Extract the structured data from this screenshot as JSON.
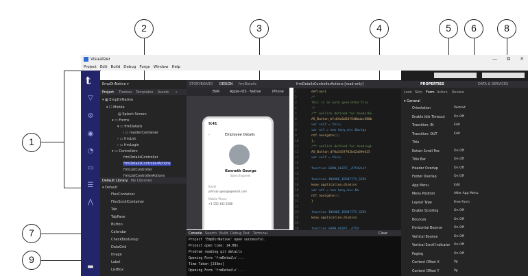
{
  "callouts": [
    "1",
    "2",
    "3",
    "4",
    "5",
    "6",
    "7",
    "8",
    "9"
  ],
  "window": {
    "title": "Visualizer",
    "min": "—",
    "restore": "⧉",
    "close": "✕"
  },
  "menu": [
    "Project",
    "Edit",
    "Build",
    "Debug",
    "Forge",
    "Window",
    "Help"
  ],
  "rail": {
    "logo": "t"
  },
  "project": {
    "selector": "EmpDirNative ▾",
    "tabs": [
      "Project",
      "Themes",
      "Templates",
      "Assets"
    ],
    "tree": [
      "▾ ▦ EmpDirNative",
      "▾ ☐ Mobile",
      "▤ Splash Screen",
      "▾ ▭ Forms",
      "▾ ▭ frmDetails",
      "› ▭ masterContainer",
      "› ▭ frmList",
      "› ▭ frmLogin",
      "▾ ▭ Controllers",
      "frmDetailsController",
      "frmDetailsControllerActions",
      "frmListController",
      "frmListControllerActions"
    ],
    "selected_index": 10
  },
  "library": {
    "tabs": [
      "Default Library",
      "My Libraries"
    ],
    "section": "▾ Default",
    "items": [
      "FlexContainer",
      "FlexScrollContainer",
      "Tab",
      "TabPane",
      "Button",
      "Calendar",
      "CheckBoxGroup",
      "DataGrid",
      "Image",
      "Label",
      "ListBox"
    ]
  },
  "design": {
    "tabs": [
      "STORYBOARD",
      "DESIGN",
      "frmDetails"
    ],
    "toolbar": [
      "BVR",
      "Apple-iOS · Native",
      "iPhone"
    ],
    "phone": {
      "time": "9:41",
      "title": "Employee Details",
      "name": "Kenneth George",
      "role": "Sales Engineer",
      "field1": "Email",
      "value1": "johnson.george@email.com",
      "field2": "Mobile Phone",
      "value2": "+1 555 443 5588"
    }
  },
  "editor": {
    "tab": "frmDetailsControllerActions [read-only]",
    "lines": [
      "define({",
      "  /*",
      "    This is an auto generated file",
      "  */",
      "  /** onClick defined for headerBu",
      "  AS_Button_bfc64c6d54f546babc500b",
      "      var self = this;",
      "      var ntf = new kony.mvc.Naviga",
      "      ntf.navigate();",
      "  },",
      "  /** onClick defined for headingL",
      "  AS_Button_df0a343f702b42a69ed25",
      "      var self = this;",
      "",
      "      function SHOW_ALERT__d7542a1f",
      "",
      "      function INVOKE_IDENTITY_SERV",
      "          kony.application.dismiss",
      "          var ntf = new kony.mvc.Na",
      "          ntf.navigate();",
      "      }",
      "",
      "      function INVOKE_IDENTITY_SERV",
      "          kony.application.dismiss",
      "",
      "      function SHOW_ALERT__d754"
    ]
  },
  "top_right": {
    "tabs": [
      "PROPERTIES",
      "DATA & SERVICES"
    ]
  },
  "props": {
    "tabs": [
      "Look",
      "Skin",
      "Form",
      "Action",
      "Review"
    ],
    "section": "▾ General",
    "rows": [
      {
        "label": "Orientation",
        "value": "Portrait"
      },
      {
        "label": "Enable Idle Timeout",
        "value": "On  Off"
      },
      {
        "label": "Transition: IN",
        "value": "Edit"
      },
      {
        "label": "Transition: OUT",
        "value": "Edit"
      },
      {
        "label": "Title",
        "value": ""
      },
      {
        "label": "Retain Scroll Pos",
        "value": "On  Off"
      },
      {
        "label": "Title Bar",
        "value": "On  Off"
      },
      {
        "label": "Header Overlap",
        "value": "On  Off"
      },
      {
        "label": "Footer Overlap",
        "value": "On  Off"
      },
      {
        "label": "App Menu",
        "value": "Edit"
      },
      {
        "label": "Menu Position",
        "value": "After App Menu"
      },
      {
        "label": "Layout Type",
        "value": "Free Form"
      },
      {
        "label": "Enable Scrolling",
        "value": "On  Off"
      },
      {
        "label": "Bounces",
        "value": "On  Off"
      },
      {
        "label": "Horizontal Bounce",
        "value": "On  Off"
      },
      {
        "label": "Vertical Bounce",
        "value": "On  Off"
      },
      {
        "label": "Vertical Scroll Indicator",
        "value": "On  Off"
      },
      {
        "label": "Paging",
        "value": "On  Off"
      },
      {
        "label": "Content Offset X",
        "value": "0p"
      },
      {
        "label": "Content Offset Y",
        "value": "0p"
      }
    ]
  },
  "console": {
    "tabs": [
      "Console",
      "Search",
      "Build",
      "Debug",
      "Test",
      "Terminal"
    ],
    "clear": "Clear",
    "lines": [
      "Project 'EmpDirNative' open successful.",
      "Project open time: 14.08s",
      "Problem reading git details",
      "Opening Form 'frmDetails'...",
      "Time Taken [233ms]",
      "Opening Form 'frmDetails'..."
    ]
  }
}
